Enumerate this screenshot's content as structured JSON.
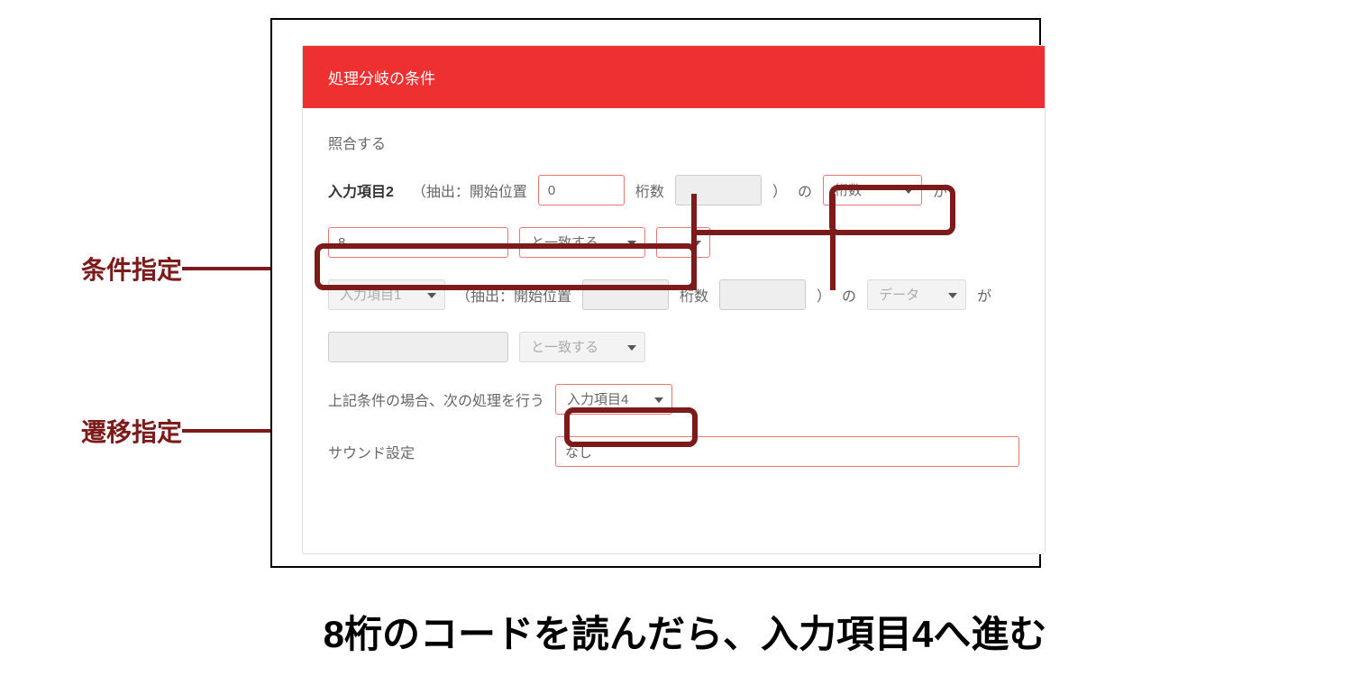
{
  "annotations": {
    "condition_spec": "条件指定",
    "transition_spec": "遷移指定"
  },
  "panel": {
    "header_title": "処理分岐の条件",
    "verify_label": "照合する",
    "verify_on": true
  },
  "row1": {
    "item_label": "入力項目2",
    "extract_prefix": "（抽出：開始位置",
    "start_value": "0",
    "digits_label": "桁数",
    "close_paren": "）",
    "no": "の",
    "digits_select": "桁数",
    "ga": "が"
  },
  "row2": {
    "value": "8",
    "match_label": "と一致する"
  },
  "row3": {
    "item_select": "入力項目1",
    "extract_prefix": "（抽出：開始位置",
    "digits_label": "桁数",
    "close_paren": "）",
    "no": "の",
    "data_select": "データ",
    "ga": "が"
  },
  "row4": {
    "match_label": "と一致する"
  },
  "row5": {
    "next_label": "上記条件の場合、次の処理を行う",
    "next_value": "入力項目4"
  },
  "row6": {
    "sound_label": "サウンド設定",
    "sound_value": "なし"
  },
  "caption": "8桁のコードを読んだら、入力項目4へ進む"
}
